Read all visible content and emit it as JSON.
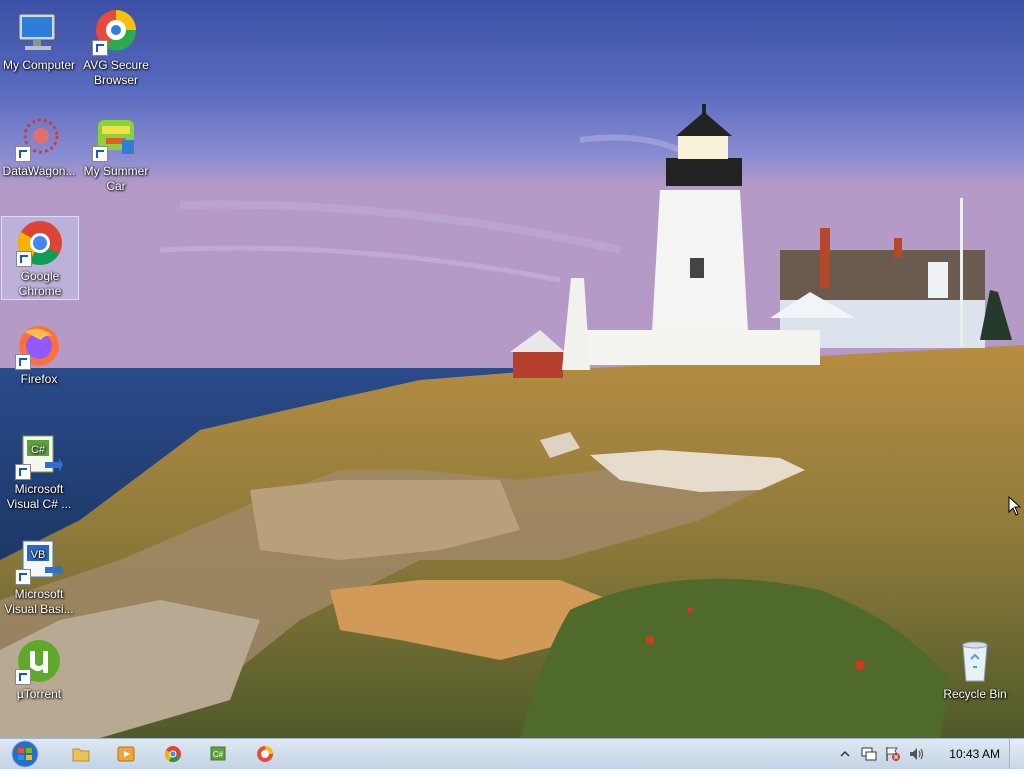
{
  "desktop": {
    "icons": [
      {
        "label": "My Computer"
      },
      {
        "label": "AVG Secure Browser"
      },
      {
        "label": "DataWagon..."
      },
      {
        "label": "My Summer Car"
      },
      {
        "label": "Google Chrome"
      },
      {
        "label": "Firefox"
      },
      {
        "label": "Microsoft Visual C# ..."
      },
      {
        "label": "Microsoft Visual Basi..."
      },
      {
        "label": "µTorrent"
      },
      {
        "label": "Recycle Bin"
      }
    ]
  },
  "taskbar": {
    "pinned": [
      "file-explorer-icon",
      "media-player-icon",
      "chrome-icon",
      "visual-csharp-icon",
      "avg-browser-icon"
    ],
    "clock": "10:43 AM"
  },
  "colors": {
    "taskbar_bg": "#d3dfee",
    "selection": "#cbdcff"
  }
}
